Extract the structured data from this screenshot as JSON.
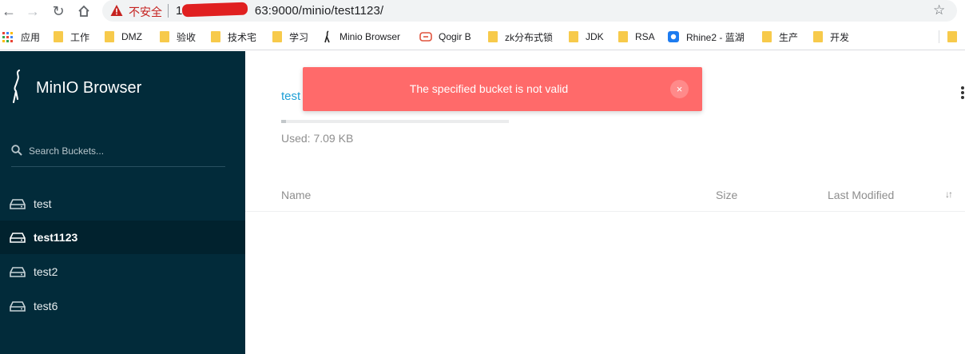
{
  "browser": {
    "url_warning": "不安全",
    "url_prefix": "10",
    "url_suffix": "63:9000/minio/test1123/",
    "bookmarks": [
      {
        "label": "应用",
        "icon": "apps-grid-icon"
      },
      {
        "label": "工作",
        "icon": "folder-icon"
      },
      {
        "label": "DMZ",
        "icon": "folder-icon"
      },
      {
        "label": "验收",
        "icon": "folder-icon"
      },
      {
        "label": "技术宅",
        "icon": "folder-icon"
      },
      {
        "label": "学习",
        "icon": "folder-icon"
      },
      {
        "label": "Minio Browser",
        "icon": "minio-logo-icon"
      },
      {
        "label": "Qogir B",
        "icon": "qogir-icon"
      },
      {
        "label": "zk分布式锁",
        "icon": "folder-icon"
      },
      {
        "label": "JDK",
        "icon": "folder-icon"
      },
      {
        "label": "RSA",
        "icon": "folder-icon"
      },
      {
        "label": "Rhine2 - 蓝湖",
        "icon": "lanhu-icon"
      },
      {
        "label": "生产",
        "icon": "folder-icon"
      },
      {
        "label": "开发",
        "icon": "folder-icon"
      }
    ]
  },
  "sidebar": {
    "brand": "MinIO Browser",
    "search_placeholder": "Search Buckets...",
    "buckets": [
      {
        "name": "test",
        "active": false
      },
      {
        "name": "test1123",
        "active": true
      },
      {
        "name": "test2",
        "active": false
      },
      {
        "name": "test6",
        "active": false
      }
    ]
  },
  "main": {
    "breadcrumb": "test",
    "used_label": "Used: 7.09 KB",
    "usage_fraction": 0.02,
    "columns": {
      "name": "Name",
      "size": "Size",
      "modified": "Last Modified"
    }
  },
  "toast": {
    "message": "The specified bucket is not valid",
    "close_symbol": "×"
  },
  "colors": {
    "sidebar_bg": "#022b3a",
    "toast_bg": "#ff6a6a",
    "link": "#1e9fd6"
  }
}
